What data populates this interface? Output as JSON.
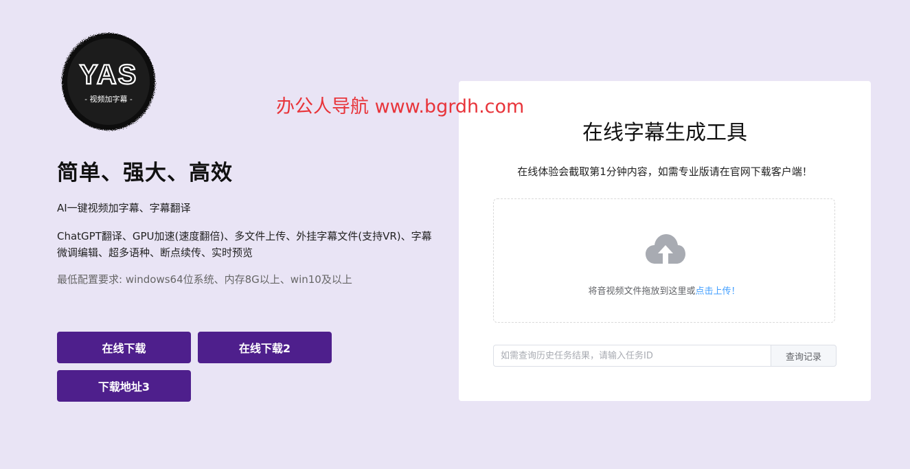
{
  "logo": {
    "main_text": "YAS",
    "sub_text": "- 视频加字幕 -"
  },
  "left": {
    "tagline": "简单、强大、高效",
    "feature_line1": "AI一键视频加字幕、字幕翻译",
    "feature_line2": "ChatGPT翻译、GPU加速(速度翻倍)、多文件上传、外挂字幕文件(支持VR)、字幕微调编辑、超多语种、断点续传、实时预览",
    "requirements": "最低配置要求: windows64位系统、内存8G以上、win10及以上"
  },
  "buttons": {
    "download1": "在线下载",
    "download2": "在线下载2",
    "download3": "下载地址3"
  },
  "watermark": "办公人导航 www.bgrdh.com",
  "card": {
    "title": "在线字幕生成工具",
    "subtitle": "在线体验会截取第1分钟内容，如需专业版请在官网下载客户端！",
    "upload_text": "将音视频文件拖放到这里或",
    "upload_link": "点击上传！",
    "upload_icon": "cloud-upload-icon",
    "query_placeholder": "如需查询历史任务结果，请输入任务ID",
    "query_value": "",
    "query_button": "查询记录"
  },
  "colors": {
    "background": "#e9e4f5",
    "button": "#4e1f8c",
    "watermark": "#e8343a",
    "link": "#409eff",
    "icon_gray": "#a8abb2"
  }
}
